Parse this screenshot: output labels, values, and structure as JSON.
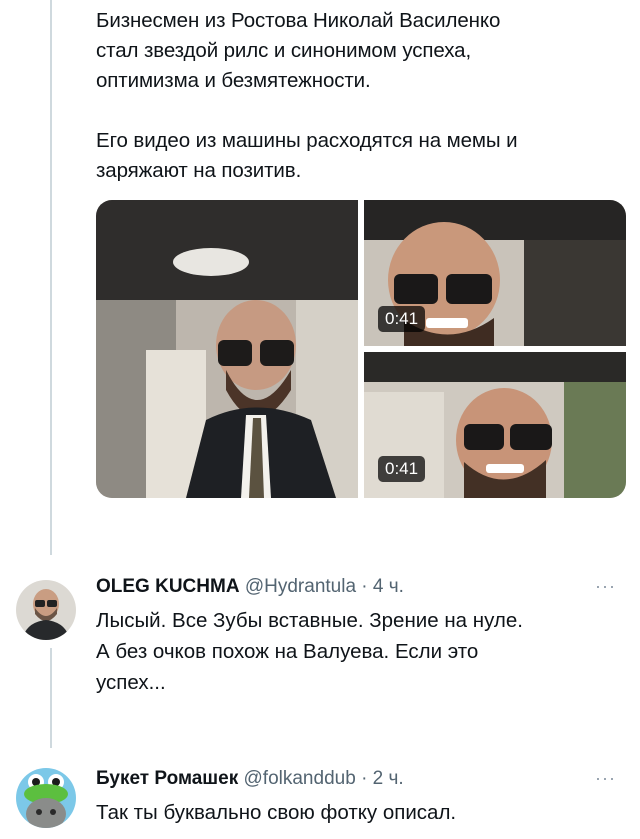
{
  "post": {
    "paragraph1_line1": "Бизнесмен из Ростова Николай Василенко",
    "paragraph1_line2": "стал звездой рилс и синонимом успеха,",
    "paragraph1_line3": "оптимизма и безмятежности.",
    "paragraph2_line1": "Его видео из машины расходятся на мемы и",
    "paragraph2_line2": "заряжают на позитив."
  },
  "media": {
    "left_photo": "man-in-car-photo",
    "top_right_video_duration": "0:41",
    "bottom_right_video_duration": "0:41"
  },
  "replies": [
    {
      "name": "OLEG KUCHMA",
      "handle": "@Hydrantula",
      "separator": "·",
      "time": "4 ч.",
      "more": "···",
      "text_line1": "Лысый. Все Зубы вставные. Зрение на нуле.",
      "text_line2": "А без очков похож на Валуева.  Если это",
      "text_line3": "успех..."
    },
    {
      "name": "Букет Ромашек",
      "handle": "@folkanddub",
      "separator": "·",
      "time": "2 ч.",
      "more": "···",
      "text_line1": "Так ты буквально свою фотку описал."
    }
  ],
  "colors": {
    "text": "#0f1419",
    "secondary": "#536471",
    "thread_line": "#cfd9de"
  }
}
